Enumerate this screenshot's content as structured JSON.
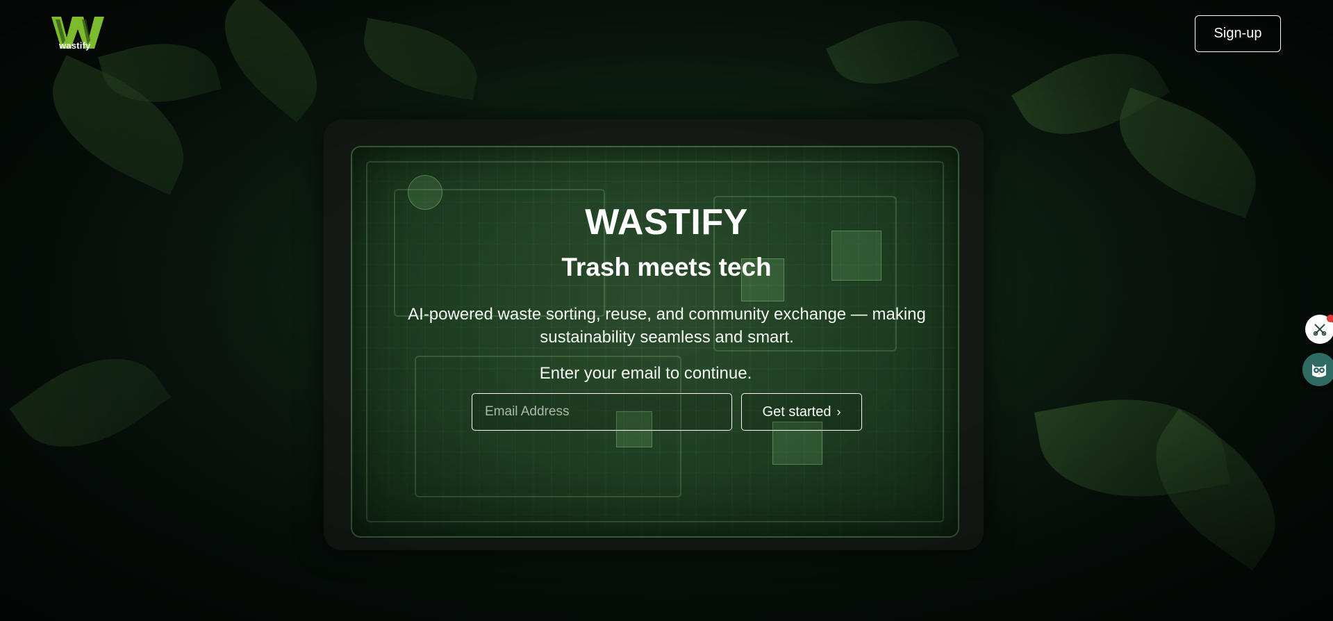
{
  "brand": {
    "name": "wastify",
    "logo_icon": "wastify-w-logo-icon",
    "accent_color": "#7dbb2e"
  },
  "header": {
    "signup_label": "Sign-up"
  },
  "hero": {
    "title": "WASTIFY",
    "subtitle": "Trash meets tech",
    "description": "AI-powered waste sorting, reuse, and community exchange — making sustainability seamless and smart.",
    "email_prompt": "Enter your email to continue.",
    "email_placeholder": "Email Address",
    "email_value": "",
    "cta_label": "Get started",
    "cta_icon": "chevron-right-icon"
  },
  "widgets": {
    "tool_icon": "crossed-tools-icon",
    "tool_badge_color": "#e43a3a",
    "assistant_icon": "owl-icon",
    "assistant_color": "#2f6b63"
  },
  "background": {
    "description_icon": "jungle-monitor-background"
  }
}
